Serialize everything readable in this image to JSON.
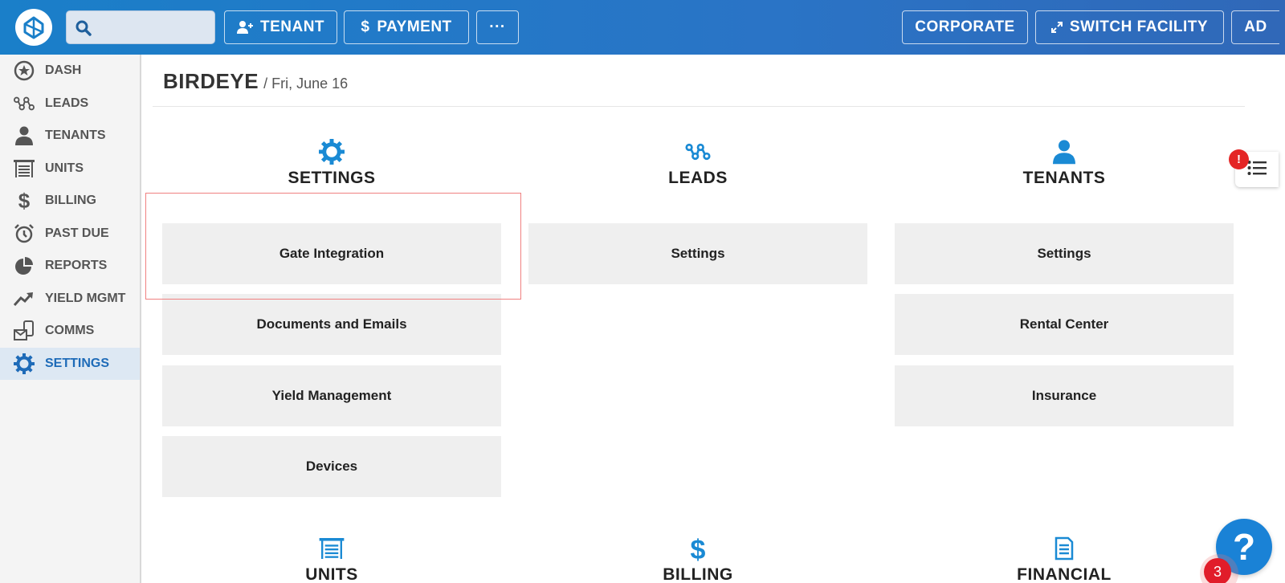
{
  "topbar": {
    "search_placeholder": "",
    "tenant_label": "TENANT",
    "payment_label": "PAYMENT",
    "more_label": "···",
    "corporate_label": "CORPORATE",
    "switch_facility_label": "SWITCH FACILITY",
    "user_label": "AD"
  },
  "sidebar": {
    "items": [
      {
        "label": "DASH",
        "icon": "star-circle-icon"
      },
      {
        "label": "LEADS",
        "icon": "leads-nodes-icon"
      },
      {
        "label": "TENANTS",
        "icon": "person-icon"
      },
      {
        "label": "UNITS",
        "icon": "garage-icon"
      },
      {
        "label": "BILLING",
        "icon": "dollar-icon"
      },
      {
        "label": "PAST DUE",
        "icon": "alarm-clock-icon"
      },
      {
        "label": "REPORTS",
        "icon": "pie-chart-icon"
      },
      {
        "label": "YIELD MGMT",
        "icon": "trend-up-icon"
      },
      {
        "label": "COMMS",
        "icon": "comms-icon"
      },
      {
        "label": "SETTINGS",
        "icon": "gear-icon",
        "active": true
      }
    ]
  },
  "page": {
    "title": "BIRDEYE",
    "date": "/ Fri, June 16"
  },
  "sections": {
    "settings": {
      "title": "SETTINGS",
      "items": [
        "Gate Integration",
        "Documents and Emails",
        "Yield Management",
        "Devices"
      ]
    },
    "leads": {
      "title": "LEADS",
      "items": [
        "Settings"
      ]
    },
    "tenants": {
      "title": "TENANTS",
      "items": [
        "Settings",
        "Rental Center",
        "Insurance"
      ]
    },
    "units": {
      "title": "UNITS"
    },
    "billing": {
      "title": "BILLING"
    },
    "financial": {
      "title": "FINANCIAL"
    }
  },
  "floating": {
    "alert_badge": "!",
    "help_label": "?",
    "help_count": "3"
  },
  "colors": {
    "accent": "#1a8ad4",
    "active_nav": "#1e6bb8",
    "alert": "#e42525"
  }
}
